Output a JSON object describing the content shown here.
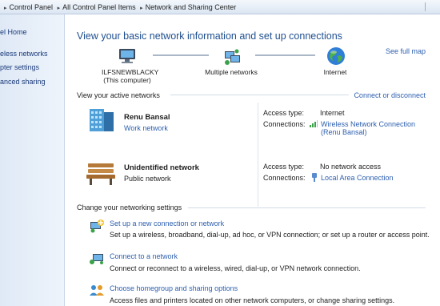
{
  "breadcrumb": {
    "items": [
      "Control Panel",
      "All Control Panel Items",
      "Network and Sharing Center"
    ],
    "separator": "▸"
  },
  "nav": {
    "items": [
      "el Home",
      "eless networks",
      "pter settings",
      "anced sharing"
    ]
  },
  "main": {
    "title": "View your basic network information and set up connections",
    "see_full_map": "See full map",
    "map": {
      "computer_name": "ILFSNEWBLACKY",
      "computer_sub": "(This computer)",
      "middle": "Multiple networks",
      "right": "Internet"
    },
    "active_header": "View your active networks",
    "connect_disconnect": "Connect or disconnect",
    "networks": [
      {
        "name": "Renu Bansal",
        "type": "Work network",
        "access_label": "Access type:",
        "access_value": "Internet",
        "conn_label": "Connections:",
        "conn_value_1": "Wireless Network Connection",
        "conn_value_2": "(Renu Bansal)"
      },
      {
        "name": "Unidentified network",
        "type": "Public network",
        "access_label": "Access type:",
        "access_value": "No network access",
        "conn_label": "Connections:",
        "conn_value_1": "Local Area Connection"
      }
    ],
    "settings_header": "Change your networking settings",
    "tasks": [
      {
        "title": "Set up a new connection or network",
        "desc": "Set up a wireless, broadband, dial-up, ad hoc, or VPN connection; or set up a router or access point."
      },
      {
        "title": "Connect to a network",
        "desc": "Connect or reconnect to a wireless, wired, dial-up, or VPN network connection."
      },
      {
        "title": "Choose homegroup and sharing options",
        "desc": "Access files and printers located on other network computers, or change sharing settings."
      }
    ]
  },
  "colors": {
    "link": "#2d5fae",
    "title": "#1f4f8f",
    "nav_bg": "#dfe9f6"
  },
  "icons": [
    "computer-icon",
    "multiple-networks-icon",
    "globe-icon",
    "office-building-icon",
    "park-bench-icon",
    "wireless-signal-icon",
    "ethernet-plug-icon",
    "new-connection-icon",
    "connect-network-icon",
    "homegroup-icon"
  ]
}
